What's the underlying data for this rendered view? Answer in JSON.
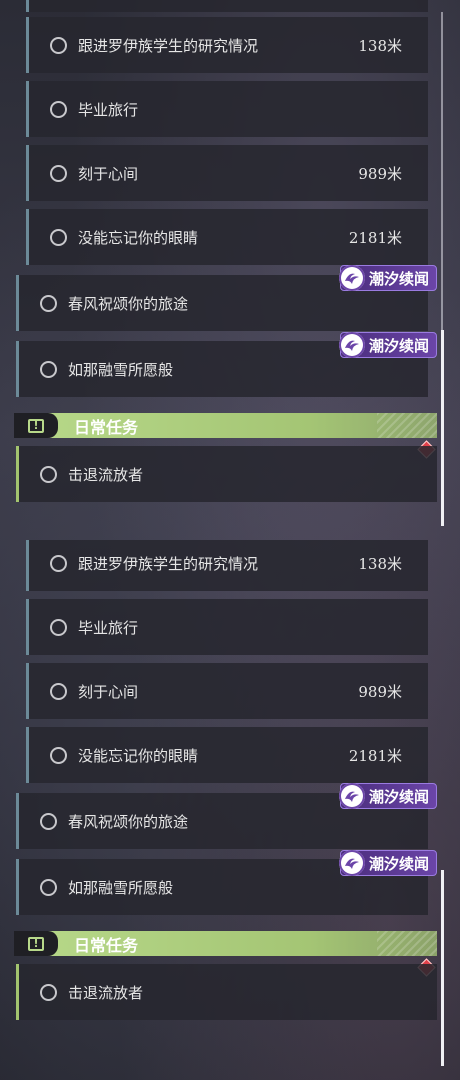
{
  "quests": {
    "track_progress": "138米",
    "track_progress_label": "跟进罗伊族学生的研究情况",
    "graduation_trip": "毕业旅行",
    "engraved": "刻于心间",
    "engraved_dist": "989米",
    "eyes": "没能忘记你的眼睛",
    "eyes_dist": "2181米",
    "spring_wind": "春风祝颂你的旅途",
    "melting_snow": "如那融雪所愿般"
  },
  "badge": {
    "label": "潮汐续闻",
    "icon": "tide-emblem-icon"
  },
  "daily": {
    "title": "日常任务",
    "alert_icon": "!",
    "task": "击退流放者"
  },
  "colors": {
    "accent_green": "#a3c46f",
    "badge_purple": "#6b45a8",
    "diamond_red": "#e0404a",
    "card_border": "#6c8a98"
  }
}
